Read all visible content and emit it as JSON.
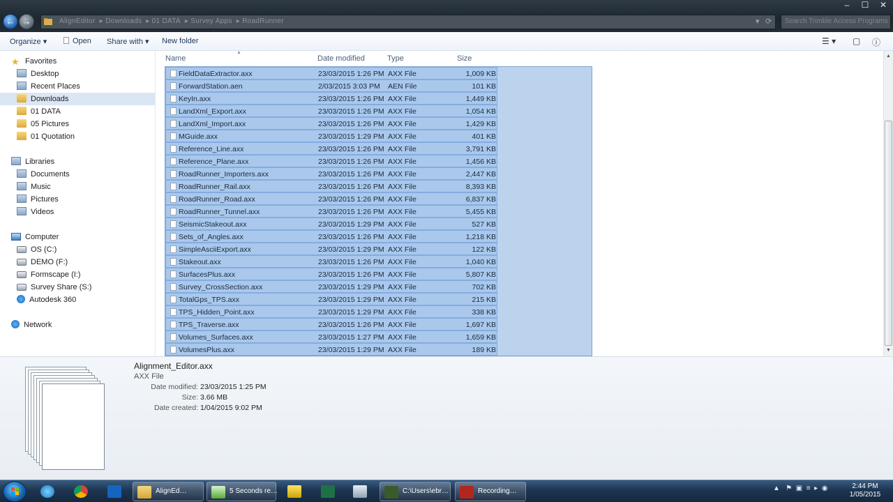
{
  "window": {
    "address_crumbs": [
      "AlignEditor",
      "Downloads",
      "01 DATA",
      "Survey Apps",
      "RoadRunner"
    ],
    "search_placeholder": "Search Trimble Access Programs",
    "controls": {
      "minimize": "–",
      "maximize": "☐",
      "close": "✕"
    }
  },
  "toolbar": {
    "organize": "Organize ▾",
    "open": "Open",
    "share_with": "Share with ▾",
    "new_folder": "New folder"
  },
  "navpane": {
    "favorites": "Favorites",
    "favorite_items": [
      "Desktop",
      "Recent Places",
      "Downloads",
      "01 DATA",
      "05 Pictures",
      "01 Quotation"
    ],
    "libraries": "Libraries",
    "library_items": [
      "Documents",
      "Music",
      "Pictures",
      "Videos"
    ],
    "computer": "Computer",
    "computer_items": [
      "OS (C:)",
      "DEMO (F:)",
      "Formscape (I:)",
      "Survey Share (S:)",
      "Autodesk 360"
    ],
    "network": "Network"
  },
  "columns": {
    "name": "Name",
    "date": "Date modified",
    "type": "Type",
    "size": "Size"
  },
  "files": [
    {
      "name": "FieldDataExtractor.axx",
      "date": "23/03/2015 1:26 PM",
      "type": "AXX File",
      "size": "1,009 KB"
    },
    {
      "name": "ForwardStation.aen",
      "date": "2/03/2015 3:03 PM",
      "type": "AEN File",
      "size": "101 KB"
    },
    {
      "name": "KeyIn.axx",
      "date": "23/03/2015 1:26 PM",
      "type": "AXX File",
      "size": "1,449 KB"
    },
    {
      "name": "LandXml_Export.axx",
      "date": "23/03/2015 1:26 PM",
      "type": "AXX File",
      "size": "1,054 KB"
    },
    {
      "name": "LandXml_Import.axx",
      "date": "23/03/2015 1:26 PM",
      "type": "AXX File",
      "size": "1,429 KB"
    },
    {
      "name": "MGuide.axx",
      "date": "23/03/2015 1:29 PM",
      "type": "AXX File",
      "size": "401 KB"
    },
    {
      "name": "Reference_Line.axx",
      "date": "23/03/2015 1:26 PM",
      "type": "AXX File",
      "size": "3,791 KB"
    },
    {
      "name": "Reference_Plane.axx",
      "date": "23/03/2015 1:26 PM",
      "type": "AXX File",
      "size": "1,456 KB"
    },
    {
      "name": "RoadRunner_Importers.axx",
      "date": "23/03/2015 1:26 PM",
      "type": "AXX File",
      "size": "2,447 KB"
    },
    {
      "name": "RoadRunner_Rail.axx",
      "date": "23/03/2015 1:26 PM",
      "type": "AXX File",
      "size": "8,393 KB"
    },
    {
      "name": "RoadRunner_Road.axx",
      "date": "23/03/2015 1:26 PM",
      "type": "AXX File",
      "size": "6,837 KB"
    },
    {
      "name": "RoadRunner_Tunnel.axx",
      "date": "23/03/2015 1:26 PM",
      "type": "AXX File",
      "size": "5,455 KB"
    },
    {
      "name": "SeismicStakeout.axx",
      "date": "23/03/2015 1:29 PM",
      "type": "AXX File",
      "size": "527 KB"
    },
    {
      "name": "Sets_of_Angles.axx",
      "date": "23/03/2015 1:26 PM",
      "type": "AXX File",
      "size": "1,218 KB"
    },
    {
      "name": "SimpleAsciiExport.axx",
      "date": "23/03/2015 1:29 PM",
      "type": "AXX File",
      "size": "122 KB"
    },
    {
      "name": "Stakeout.axx",
      "date": "23/03/2015 1:26 PM",
      "type": "AXX File",
      "size": "1,040 KB"
    },
    {
      "name": "SurfacesPlus.axx",
      "date": "23/03/2015 1:26 PM",
      "type": "AXX File",
      "size": "5,807 KB"
    },
    {
      "name": "Survey_CrossSection.axx",
      "date": "23/03/2015 1:29 PM",
      "type": "AXX File",
      "size": "702 KB"
    },
    {
      "name": "TotalGps_TPS.axx",
      "date": "23/03/2015 1:29 PM",
      "type": "AXX File",
      "size": "215 KB"
    },
    {
      "name": "TPS_Hidden_Point.axx",
      "date": "23/03/2015 1:29 PM",
      "type": "AXX File",
      "size": "338 KB"
    },
    {
      "name": "TPS_Traverse.axx",
      "date": "23/03/2015 1:26 PM",
      "type": "AXX File",
      "size": "1,697 KB"
    },
    {
      "name": "Volumes_Surfaces.axx",
      "date": "23/03/2015 1:27 PM",
      "type": "AXX File",
      "size": "1,659 KB"
    },
    {
      "name": "VolumesPlus.axx",
      "date": "23/03/2015 1:29 PM",
      "type": "AXX File",
      "size": "189 KB"
    }
  ],
  "details": {
    "filename": "Alignment_Editor.axx",
    "filetype": "AXX File",
    "date_modified_label": "Date modified:",
    "date_modified": "23/03/2015 1:25 PM",
    "size_label": "Size:",
    "size": "3.66 MB",
    "date_created_label": "Date created:",
    "date_created": "1/04/2015 9:02 PM"
  },
  "taskbar": {
    "apps": [
      {
        "label": "AlignEd…",
        "name": "taskbar-explorer"
      },
      {
        "label": "5 Seconds re…",
        "name": "taskbar-5-seconds"
      },
      {
        "label": "C:\\Users\\ebr…",
        "name": "taskbar-cmd"
      },
      {
        "label": "Recording…",
        "name": "taskbar-recording"
      }
    ],
    "time": "2:44 PM",
    "date": "1/05/2015"
  }
}
